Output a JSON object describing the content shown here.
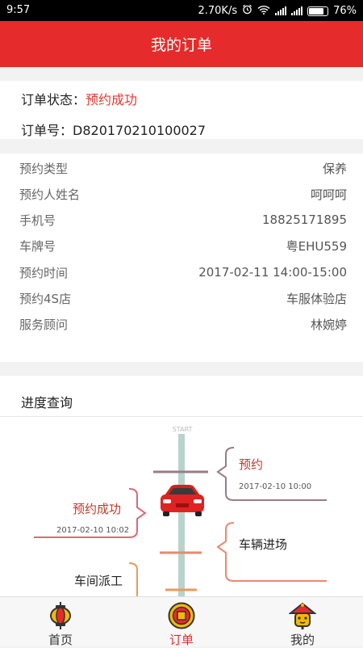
{
  "status_bar": {
    "time": "9:57",
    "speed": "2.70K/s",
    "battery": "76%"
  },
  "header": {
    "title": "我的订单"
  },
  "order": {
    "status_label": "订单状态：",
    "status_value": "预约成功",
    "number_label": "订单号：",
    "number_value": "D820170210100027"
  },
  "details": [
    {
      "label": "预约类型",
      "value": "保养"
    },
    {
      "label": "预约人姓名",
      "value": "呵呵呵"
    },
    {
      "label": "手机号",
      "value": "18825171895"
    },
    {
      "label": "车牌号",
      "value": "粤EHU559"
    },
    {
      "label": "预约时间",
      "value": "2017-02-11 14:00-15:00"
    },
    {
      "label": "预约4S店",
      "value": "车服体验店"
    },
    {
      "label": "服务顾问",
      "value": "林婉婷"
    }
  ],
  "progress": {
    "title": "进度查询",
    "start_label": "START",
    "steps": [
      {
        "text": "预约",
        "time": "2017-02-10 10:00"
      },
      {
        "text": "预约成功",
        "time": "2017-02-10 10:02"
      },
      {
        "text": "车辆进场",
        "time": ""
      },
      {
        "text": "车间派工",
        "time": ""
      }
    ]
  },
  "colors": {
    "brand": "#e52b2b",
    "accent_text": "#e03a2e",
    "step1": "#9b7b86",
    "step2": "#d96a7b",
    "step3": "#e98970",
    "step4": "#e99a5e"
  },
  "nav": [
    {
      "label": "首页",
      "icon": "lantern-icon"
    },
    {
      "label": "订单",
      "icon": "coin-icon"
    },
    {
      "label": "我的",
      "icon": "mascot-icon"
    }
  ]
}
